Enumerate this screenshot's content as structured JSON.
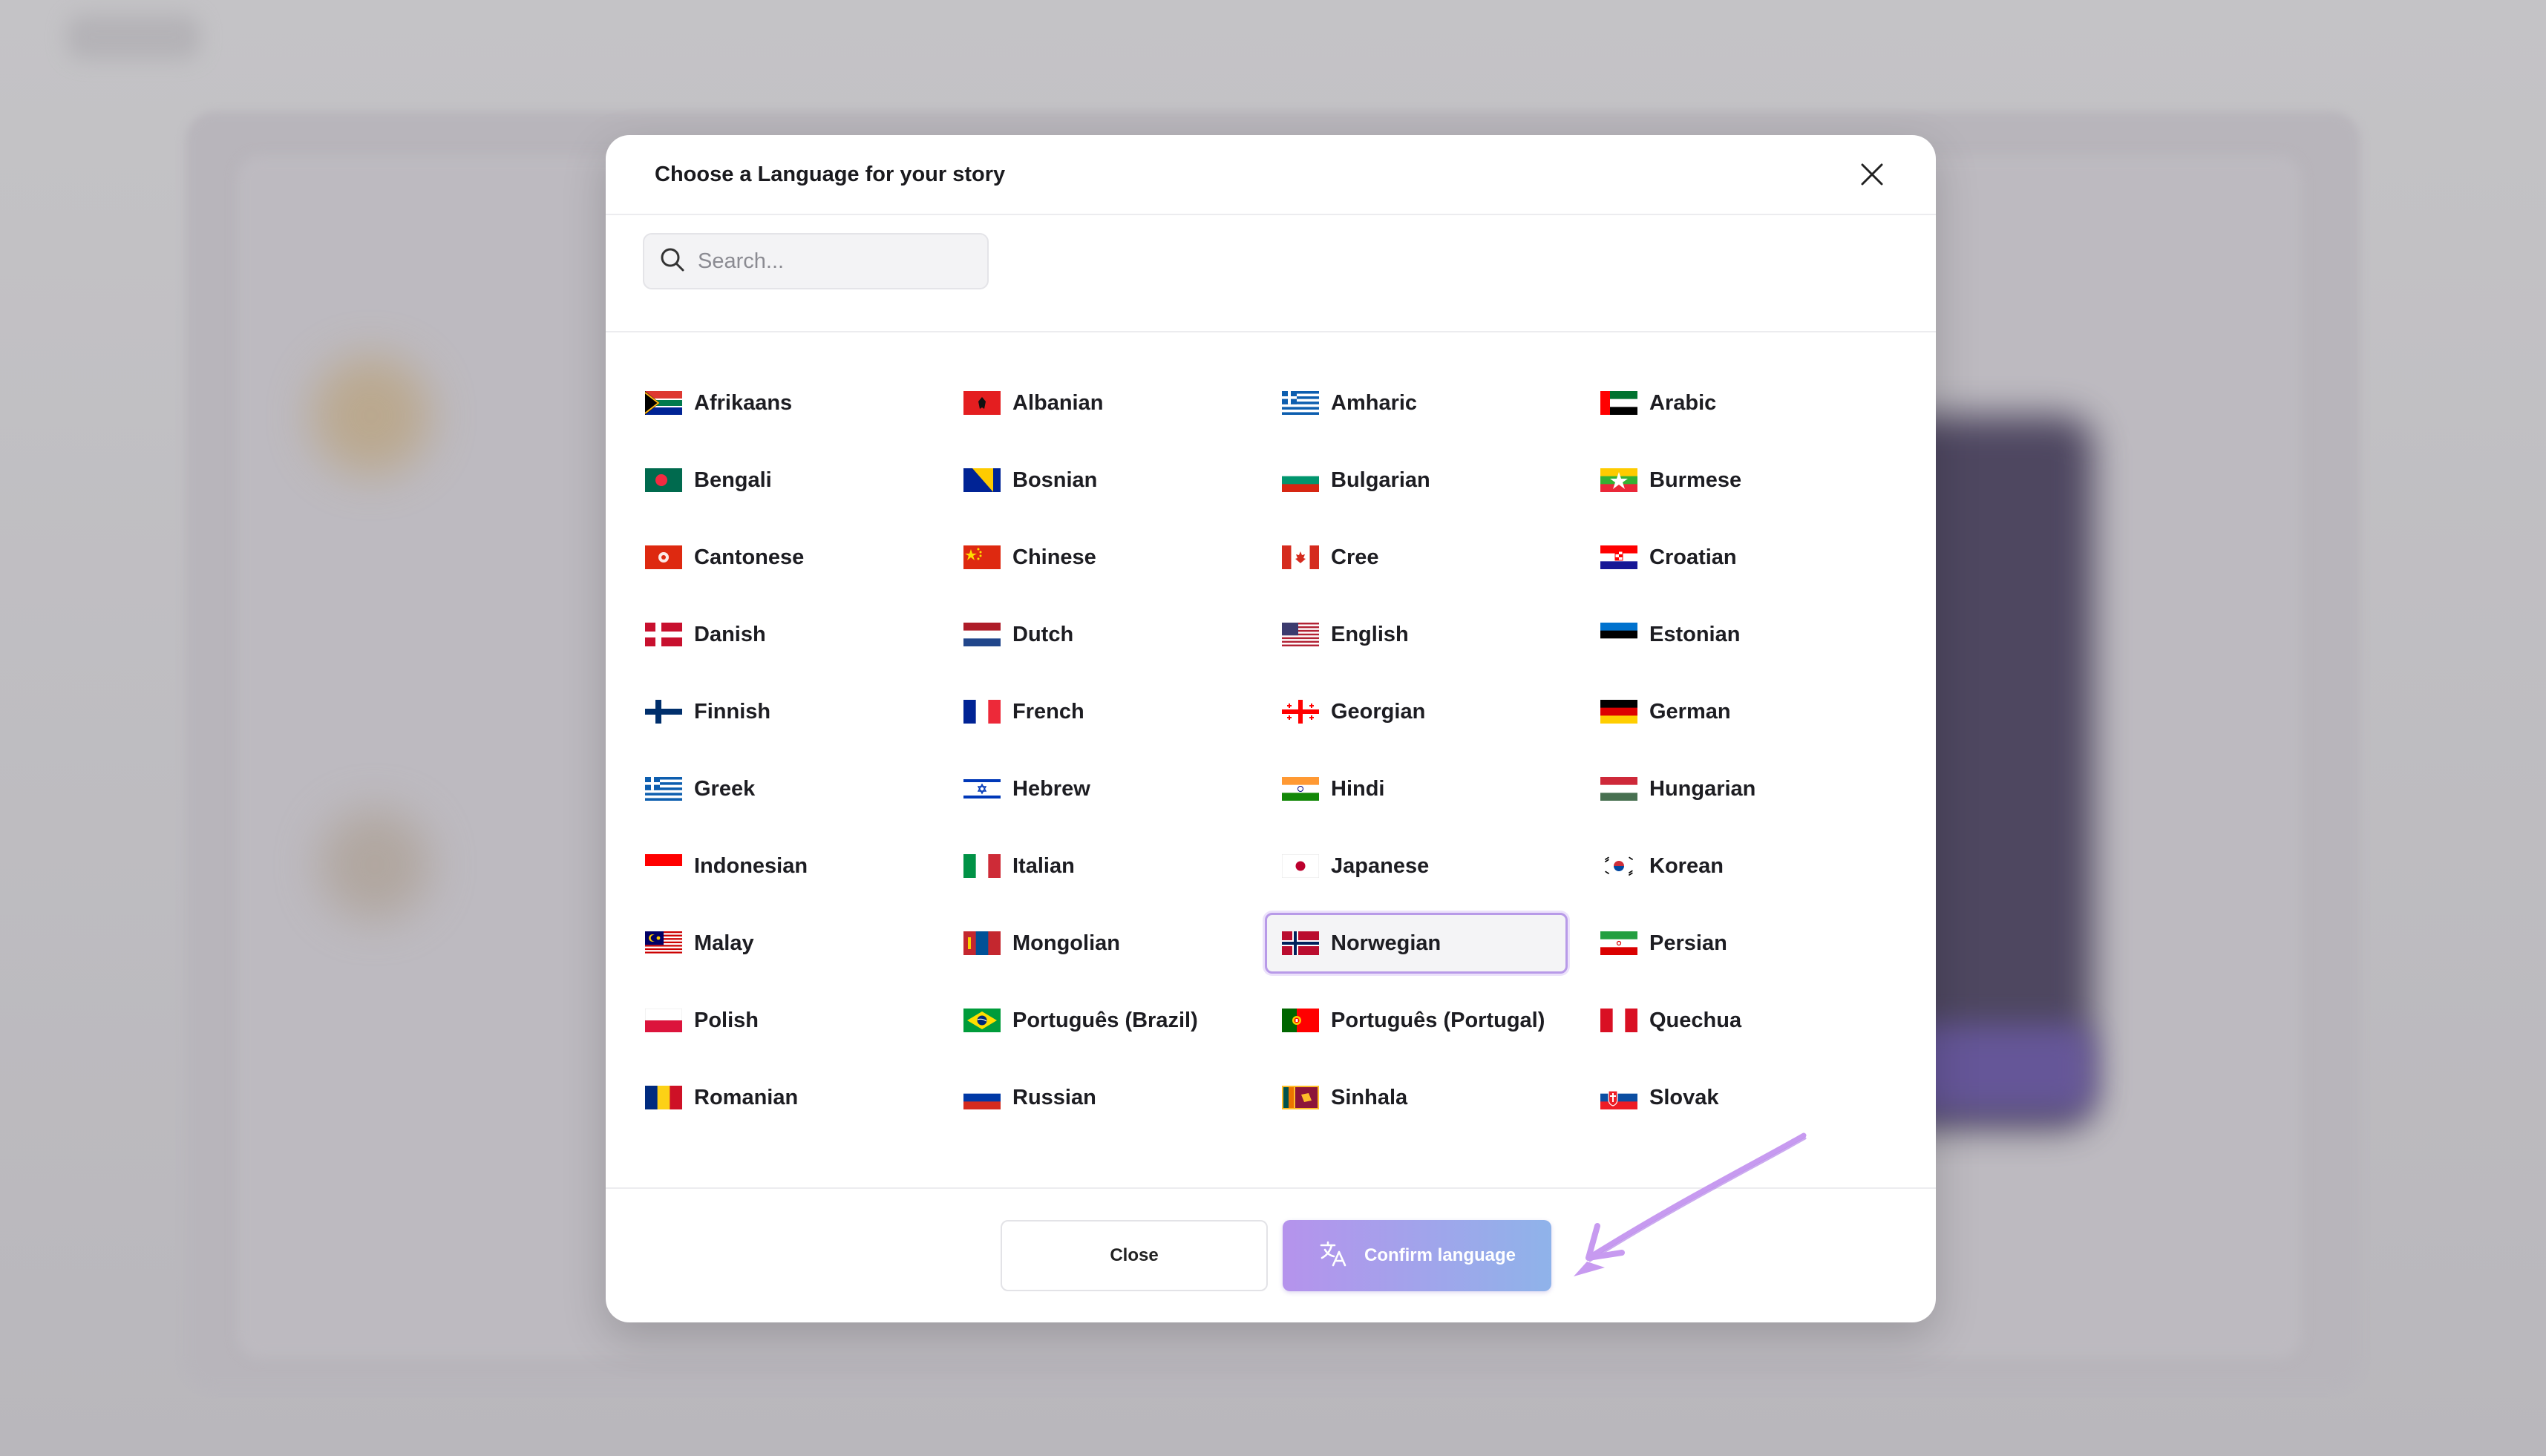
{
  "modal": {
    "title": "Choose a Language for your story",
    "search_placeholder": "Search...",
    "selected": "Norwegian",
    "close_label": "Close",
    "confirm_label": "Confirm language"
  },
  "languages": [
    {
      "label": "Afrikaans",
      "flag": "za"
    },
    {
      "label": "Albanian",
      "flag": "al"
    },
    {
      "label": "Amharic",
      "flag": "gr"
    },
    {
      "label": "Arabic",
      "flag": "ae"
    },
    {
      "label": "Bengali",
      "flag": "bd"
    },
    {
      "label": "Bosnian",
      "flag": "ba"
    },
    {
      "label": "Bulgarian",
      "flag": "bg"
    },
    {
      "label": "Burmese",
      "flag": "mm"
    },
    {
      "label": "Cantonese",
      "flag": "hk"
    },
    {
      "label": "Chinese",
      "flag": "cn"
    },
    {
      "label": "Cree",
      "flag": "ca"
    },
    {
      "label": "Croatian",
      "flag": "hr"
    },
    {
      "label": "Danish",
      "flag": "dk"
    },
    {
      "label": "Dutch",
      "flag": "nl"
    },
    {
      "label": "English",
      "flag": "us"
    },
    {
      "label": "Estonian",
      "flag": "ee"
    },
    {
      "label": "Finnish",
      "flag": "fi"
    },
    {
      "label": "French",
      "flag": "fr"
    },
    {
      "label": "Georgian",
      "flag": "ge"
    },
    {
      "label": "German",
      "flag": "de"
    },
    {
      "label": "Greek",
      "flag": "gr"
    },
    {
      "label": "Hebrew",
      "flag": "il"
    },
    {
      "label": "Hindi",
      "flag": "in"
    },
    {
      "label": "Hungarian",
      "flag": "hu"
    },
    {
      "label": "Indonesian",
      "flag": "id"
    },
    {
      "label": "Italian",
      "flag": "it"
    },
    {
      "label": "Japanese",
      "flag": "jp"
    },
    {
      "label": "Korean",
      "flag": "kr"
    },
    {
      "label": "Malay",
      "flag": "my"
    },
    {
      "label": "Mongolian",
      "flag": "mn"
    },
    {
      "label": "Norwegian",
      "flag": "no"
    },
    {
      "label": "Persian",
      "flag": "ir"
    },
    {
      "label": "Polish",
      "flag": "pl"
    },
    {
      "label": "Português (Brazil)",
      "flag": "br"
    },
    {
      "label": "Português (Portugal)",
      "flag": "pt"
    },
    {
      "label": "Quechua",
      "flag": "pe"
    },
    {
      "label": "Romanian",
      "flag": "ro"
    },
    {
      "label": "Russian",
      "flag": "ru"
    },
    {
      "label": "Sinhala",
      "flag": "lk"
    },
    {
      "label": "Slovak",
      "flag": "sk"
    }
  ],
  "colors": {
    "accent_border": "#b89ae8",
    "confirm_gradient_start": "#b593ec",
    "confirm_gradient_end": "#8fb3ea",
    "annotation_arrow": "#c79af0"
  },
  "icons": {
    "search": "search-icon",
    "close": "close-icon",
    "translate": "translate-icon",
    "annotation": "arrow-annotation"
  }
}
